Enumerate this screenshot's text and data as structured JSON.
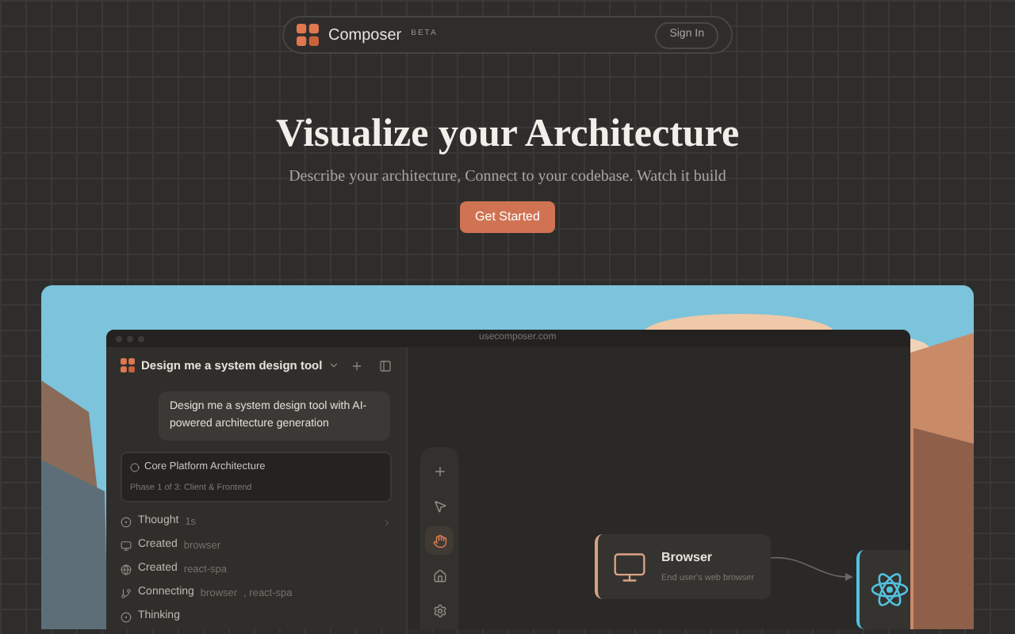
{
  "nav": {
    "brand": "Composer",
    "badge": "BETA",
    "sign_in": "Sign In"
  },
  "hero": {
    "title": "Visualize your Architecture",
    "subtitle": "Describe your architecture, Connect to your codebase. Watch it build",
    "cta": "Get Started"
  },
  "app": {
    "url": "usecomposer.com",
    "chat_title": "Design me a system design tool",
    "user_message": "Design me a system design tool with AI-powered architecture generation",
    "task": {
      "title": "Core Platform Architecture",
      "phase": "Phase 1 of 3: Client & Frontend"
    },
    "steps": [
      {
        "kind": "thought",
        "label": "Thought",
        "details": [
          "1s"
        ],
        "expandable": true
      },
      {
        "kind": "monitor",
        "label": "Created",
        "details": [
          "browser"
        ],
        "expandable": false
      },
      {
        "kind": "globe",
        "label": "Created",
        "details": [
          "react-spa"
        ],
        "expandable": false
      },
      {
        "kind": "branch",
        "label": "Connecting",
        "details": [
          "browser",
          ", react-spa"
        ],
        "expandable": false
      },
      {
        "kind": "thought",
        "label": "Thinking",
        "expandable": false
      }
    ],
    "tools": [
      {
        "kind": "plus",
        "selected": false
      },
      {
        "kind": "pointer",
        "selected": false
      },
      {
        "kind": "hand",
        "selected": true
      },
      {
        "kind": "home",
        "selected": false
      },
      {
        "kind": "settings",
        "selected": false
      }
    ],
    "nodes": [
      {
        "kind": "browser",
        "title": "Browser",
        "subtitle": "End user's web browser"
      },
      {
        "kind": "react"
      }
    ]
  }
}
